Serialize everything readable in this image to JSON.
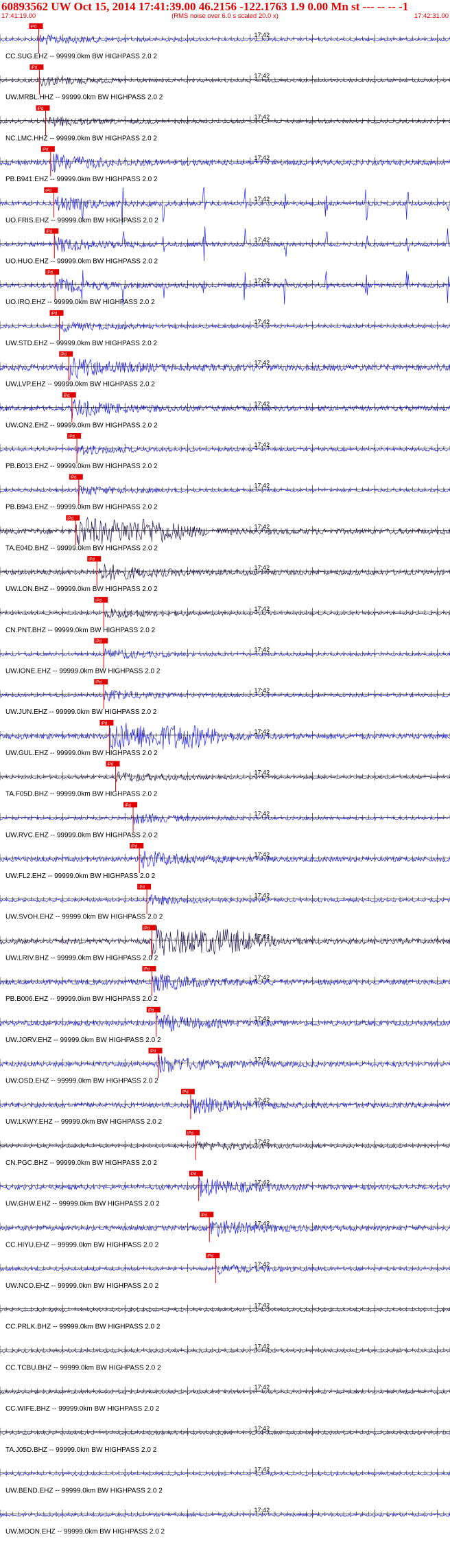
{
  "header": {
    "title": "60893562 UW Oct 15, 2014 17:41:39.00   46.2156 -122.1763  1.9 0.00 Mn st --- -- --  -1",
    "start_time": "17:41:19.00",
    "noise_note": "(RMS noise over 6.0 s scaled 20.0 x)",
    "end_time": "17:42:31.00"
  },
  "colors": {
    "vertical": "#1f1fe6",
    "horizontal": "#24174e",
    "pick": "#e00000",
    "tick": "#000000",
    "label": "#000000"
  },
  "chart_data": {
    "type": "line",
    "x_range": [
      "17:41:19.00",
      "17:42:31.00"
    ],
    "minute_label": "17:42",
    "minute_at_s": 41,
    "pick_label": "iPd",
    "filter": "99999.0km BW  HIGHPASS  2.0  2",
    "traces": [
      {
        "label": "CC.SUG.EHZ -- 99999.0km BW  HIGHPASS  2.0  2",
        "kind": "v",
        "pick_s": 6.2,
        "energy": "low",
        "onset_s": 6.2
      },
      {
        "label": "UW.MRBL.HHZ -- 99999.0km BW  HIGHPASS  2.0  2",
        "kind": "h",
        "pick_s": 6.3,
        "energy": "low",
        "onset_s": 6.3
      },
      {
        "label": "NC.LMC.HHZ -- 99999.0km BW  HIGHPASS  2.0  2",
        "kind": "h",
        "pick_s": 7.3,
        "energy": "low",
        "onset_s": 7.3
      },
      {
        "label": "PB.B941.EHZ -- 99999.0km BW  HIGHPASS  2.0  2",
        "kind": "v",
        "pick_s": 8.1,
        "energy": "mid",
        "onset_s": 8.1
      },
      {
        "label": "UO.FRIS.EHZ -- 99999.0km BW  HIGHPASS  2.0  2",
        "kind": "v",
        "pick_s": 8.6,
        "energy": "spikes",
        "onset_s": 8.6
      },
      {
        "label": "UO.HUO.EHZ -- 99999.0km BW  HIGHPASS  2.0  2",
        "kind": "v",
        "pick_s": 8.7,
        "energy": "spikes",
        "onset_s": 8.7
      },
      {
        "label": "UO.IRO.EHZ -- 99999.0km BW  HIGHPASS  2.0  2",
        "kind": "v",
        "pick_s": 8.8,
        "energy": "spikes",
        "onset_s": 8.8
      },
      {
        "label": "UW.STD.EHZ -- 99999.0km BW  HIGHPASS  2.0  2",
        "kind": "v",
        "pick_s": 9.5,
        "energy": "low",
        "onset_s": 9.5
      },
      {
        "label": "UW.LVP.EHZ -- 99999.0km BW  HIGHPASS  2.0  2",
        "kind": "v",
        "pick_s": 11.0,
        "energy": "noisy",
        "onset_s": 11.0
      },
      {
        "label": "UW.ON2.EHZ -- 99999.0km BW  HIGHPASS  2.0  2",
        "kind": "v",
        "pick_s": 11.5,
        "energy": "mid",
        "onset_s": 11.5
      },
      {
        "label": "PB.B013.EHZ -- 99999.0km BW  HIGHPASS  2.0  2",
        "kind": "v",
        "pick_s": 12.3,
        "energy": "low",
        "onset_s": 12.3
      },
      {
        "label": "PB.B943.EHZ -- 99999.0km BW  HIGHPASS  2.0  2",
        "kind": "v",
        "pick_s": 12.6,
        "energy": "low",
        "onset_s": 12.6
      },
      {
        "label": "TA.E04D.BHZ -- 99999.0km BW  HIGHPASS  2.0  2",
        "kind": "h",
        "pick_s": 12.1,
        "energy": "high",
        "onset_s": 12.1
      },
      {
        "label": "UW.LON.BHZ -- 99999.0km BW  HIGHPASS  2.0  2",
        "kind": "h",
        "pick_s": 15.5,
        "energy": "mid",
        "onset_s": 15.5
      },
      {
        "label": "CN.PNT.BHZ -- 99999.0km BW  HIGHPASS  2.0  2",
        "kind": "h",
        "pick_s": 16.6,
        "energy": "low",
        "onset_s": 16.6
      },
      {
        "label": "UW.IONE.EHZ -- 99999.0km BW  HIGHPASS  2.0  2",
        "kind": "v",
        "pick_s": 16.6,
        "energy": "low",
        "onset_s": 16.6
      },
      {
        "label": "UW.JUN.EHZ -- 99999.0km BW  HIGHPASS  2.0  2",
        "kind": "v",
        "pick_s": 16.6,
        "energy": "low",
        "onset_s": 16.6
      },
      {
        "label": "UW.GUL.EHZ -- 99999.0km BW  HIGHPASS  2.0  2",
        "kind": "v",
        "pick_s": 17.5,
        "energy": "high",
        "onset_s": 17.5
      },
      {
        "label": "TA.F05D.BHZ -- 99999.0km BW  HIGHPASS  2.0  2",
        "kind": "h",
        "pick_s": 18.5,
        "energy": "low",
        "onset_s": 18.5
      },
      {
        "label": "UW.RVC.EHZ -- 99999.0km BW  HIGHPASS  2.0  2",
        "kind": "v",
        "pick_s": 21.3,
        "energy": "low",
        "onset_s": 21.3
      },
      {
        "label": "UW.FL2.EHZ -- 99999.0km BW  HIGHPASS  2.0  2",
        "kind": "v",
        "pick_s": 22.3,
        "energy": "mid",
        "onset_s": 22.3
      },
      {
        "label": "UW.SVOH.EHZ -- 99999.0km BW  HIGHPASS  2.0  2",
        "kind": "v",
        "pick_s": 23.5,
        "energy": "low",
        "onset_s": 23.5
      },
      {
        "label": "UW.LRIV.BHZ -- 99999.0km BW  HIGHPASS  2.0  2",
        "kind": "h",
        "pick_s": 24.3,
        "energy": "high",
        "onset_s": 24.3
      },
      {
        "label": "PB.B006.EHZ -- 99999.0km BW  HIGHPASS  2.0  2",
        "kind": "v",
        "pick_s": 24.3,
        "energy": "mid",
        "onset_s": 24.3
      },
      {
        "label": "UW.JORV.EHZ -- 99999.0km BW  HIGHPASS  2.0  2",
        "kind": "v",
        "pick_s": 25.0,
        "energy": "mid",
        "onset_s": 25.0
      },
      {
        "label": "UW.OSD.EHZ -- 99999.0km BW  HIGHPASS  2.0  2",
        "kind": "v",
        "pick_s": 25.3,
        "energy": "mid",
        "onset_s": 25.3
      },
      {
        "label": "UW.LKWY.EHZ -- 99999.0km BW  HIGHPASS  2.0  2",
        "kind": "v",
        "pick_s": 30.5,
        "energy": "mid",
        "onset_s": 30.5
      },
      {
        "label": "CN.PGC.BHZ -- 99999.0km BW  HIGHPASS  2.0  2",
        "kind": "h",
        "pick_s": 31.3,
        "energy": "low",
        "onset_s": 31.3
      },
      {
        "label": "UW.GHW.EHZ -- 99999.0km BW  HIGHPASS  2.0  2",
        "kind": "v",
        "pick_s": 31.8,
        "energy": "mid",
        "onset_s": 31.8
      },
      {
        "label": "CC.HIYU.EHZ -- 99999.0km BW  HIGHPASS  2.0  2",
        "kind": "v",
        "pick_s": 33.5,
        "energy": "mid",
        "onset_s": 33.5
      },
      {
        "label": "UW.NCO.EHZ -- 99999.0km BW  HIGHPASS  2.0  2",
        "kind": "v",
        "pick_s": 34.5,
        "energy": "low",
        "onset_s": 34.5
      },
      {
        "label": "CC.PRLK.BHZ -- 99999.0km BW  HIGHPASS  2.0  2",
        "kind": "h",
        "pick_s": null,
        "energy": "low",
        "onset_s": null
      },
      {
        "label": "CC.TCBU.BHZ -- 99999.0km BW  HIGHPASS  2.0  2",
        "kind": "h",
        "pick_s": null,
        "energy": "low",
        "onset_s": null
      },
      {
        "label": "CC.WIFE.BHZ -- 99999.0km BW  HIGHPASS  2.0  2",
        "kind": "h",
        "pick_s": null,
        "energy": "low",
        "onset_s": null
      },
      {
        "label": "TA.J05D.BHZ -- 99999.0km BW  HIGHPASS  2.0  2",
        "kind": "h",
        "pick_s": null,
        "energy": "low",
        "onset_s": null
      },
      {
        "label": "UW.BEND.EHZ -- 99999.0km BW  HIGHPASS  2.0  2",
        "kind": "v",
        "pick_s": null,
        "energy": "low",
        "onset_s": null
      },
      {
        "label": "UW.MOON.EHZ -- 99999.0km BW  HIGHPASS  2.0  2",
        "kind": "v",
        "pick_s": null,
        "energy": "low",
        "onset_s": null
      }
    ]
  }
}
